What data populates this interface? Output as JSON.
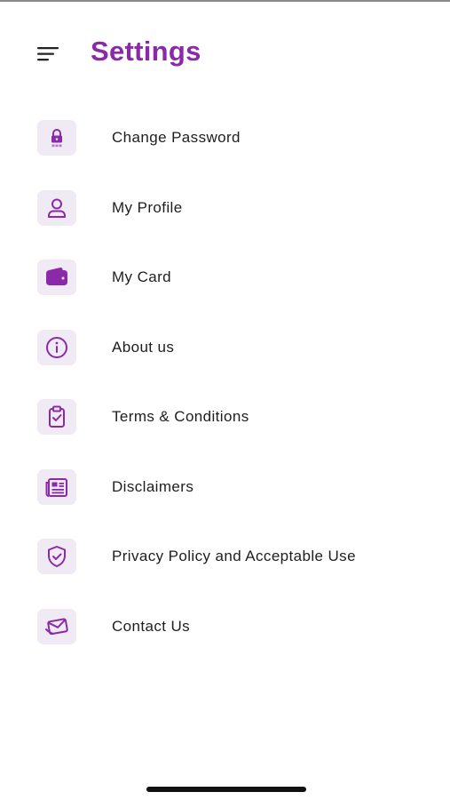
{
  "header": {
    "title": "Settings",
    "menu_icon": "hamburger-menu-icon"
  },
  "colors": {
    "accent": "#8b2aa8",
    "icon_background": "#efeaf3",
    "text": "#1e1e1e"
  },
  "menu": {
    "items": [
      {
        "label": "Change Password",
        "icon": "lock-icon"
      },
      {
        "label": "My Profile",
        "icon": "user-icon"
      },
      {
        "label": "My Card",
        "icon": "wallet-icon"
      },
      {
        "label": "About us",
        "icon": "info-icon"
      },
      {
        "label": "Terms & Conditions",
        "icon": "clipboard-check-icon"
      },
      {
        "label": "Disclaimers",
        "icon": "newspaper-icon"
      },
      {
        "label": "Privacy Policy and Acceptable Use",
        "icon": "shield-check-icon"
      },
      {
        "label": "Contact Us",
        "icon": "mail-icon"
      }
    ]
  }
}
